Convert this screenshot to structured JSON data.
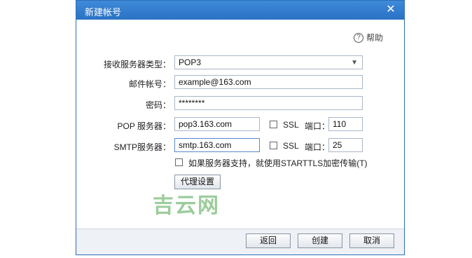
{
  "dialog": {
    "title": "新建帐号",
    "close_glyph": "✕",
    "help_label": "帮助",
    "help_icon": "?"
  },
  "form": {
    "server_type_label": "接收服务器类型：",
    "server_type_value": "POP3",
    "account_label": "邮件帐号：",
    "account_value": "example@163.com",
    "password_label": "密码：",
    "password_value": "********",
    "pop_label": "POP 服务器：",
    "pop_value": "pop3.163.com",
    "pop_ssl_label": "SSL",
    "pop_port_label": "端口：",
    "pop_port_value": "110",
    "smtp_label": "SMTP服务器：",
    "smtp_value": "smtp.163.com",
    "smtp_ssl_label": "SSL",
    "smtp_port_label": "端口：",
    "smtp_port_value": "25",
    "starttls_label": "如果服务器支持，就使用STARTTLS加密传输(T)",
    "proxy_button": "代理设置"
  },
  "footer": {
    "back_button": "返回",
    "create_button": "创建",
    "cancel_button": "取消"
  },
  "watermark": "吉云网"
}
